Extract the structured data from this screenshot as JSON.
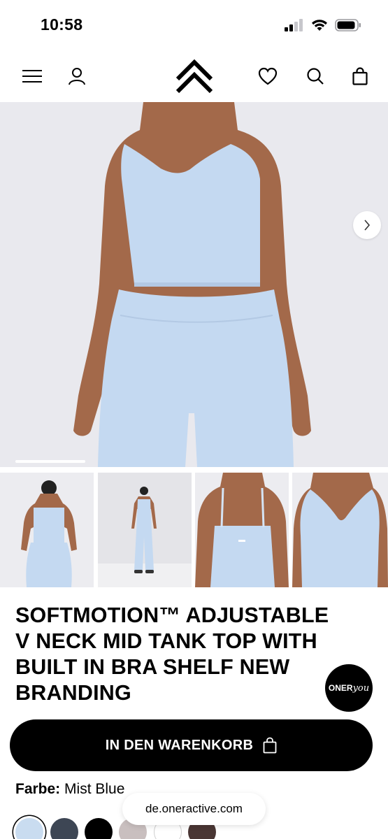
{
  "status_bar": {
    "time": "10:58",
    "icons": [
      "signal-icon",
      "wifi-icon",
      "battery-icon"
    ]
  },
  "header": {
    "icons": [
      "menu-icon",
      "account-icon",
      "brand-logo",
      "wishlist-heart-icon",
      "search-icon",
      "shopping-bag-icon"
    ]
  },
  "hero": {
    "next_icon": "chevron-right-icon",
    "image": "model-front-view",
    "carousel_progress": 0.2
  },
  "thumbnails": [
    {
      "image": "back-view"
    },
    {
      "image": "full-body-front-view"
    },
    {
      "image": "back-detail"
    },
    {
      "image": "front-detail"
    }
  ],
  "product": {
    "title_lines": [
      "SOFTMOTION™ ADJUSTABLE",
      "V NECK MID TANK TOP WITH",
      "BUILT IN BRA SHELF NEW",
      "BRANDING"
    ],
    "add_to_cart_label": "IN DEN WARENKORB",
    "color_label": "Farbe:",
    "color_value": "Mist Blue"
  },
  "chat_badge": {
    "text_main": "ONER",
    "text_accent": "you"
  },
  "browser": {
    "url": "de.oneractive.com"
  },
  "swatches": [
    {
      "name": "mist-blue",
      "color": "#c9dcf0",
      "selected": true
    },
    {
      "name": "navy",
      "color": "#3d4654"
    },
    {
      "name": "black",
      "color": "#000000"
    },
    {
      "name": "taupe",
      "color": "#c9bfbf"
    },
    {
      "name": "white",
      "color": "#ffffff"
    },
    {
      "name": "brown",
      "color": "#4a3634"
    }
  ],
  "colors": {
    "garment": "#c4d9f1",
    "skin": "#a3694a",
    "hero_bg": "#e9e9ee"
  }
}
